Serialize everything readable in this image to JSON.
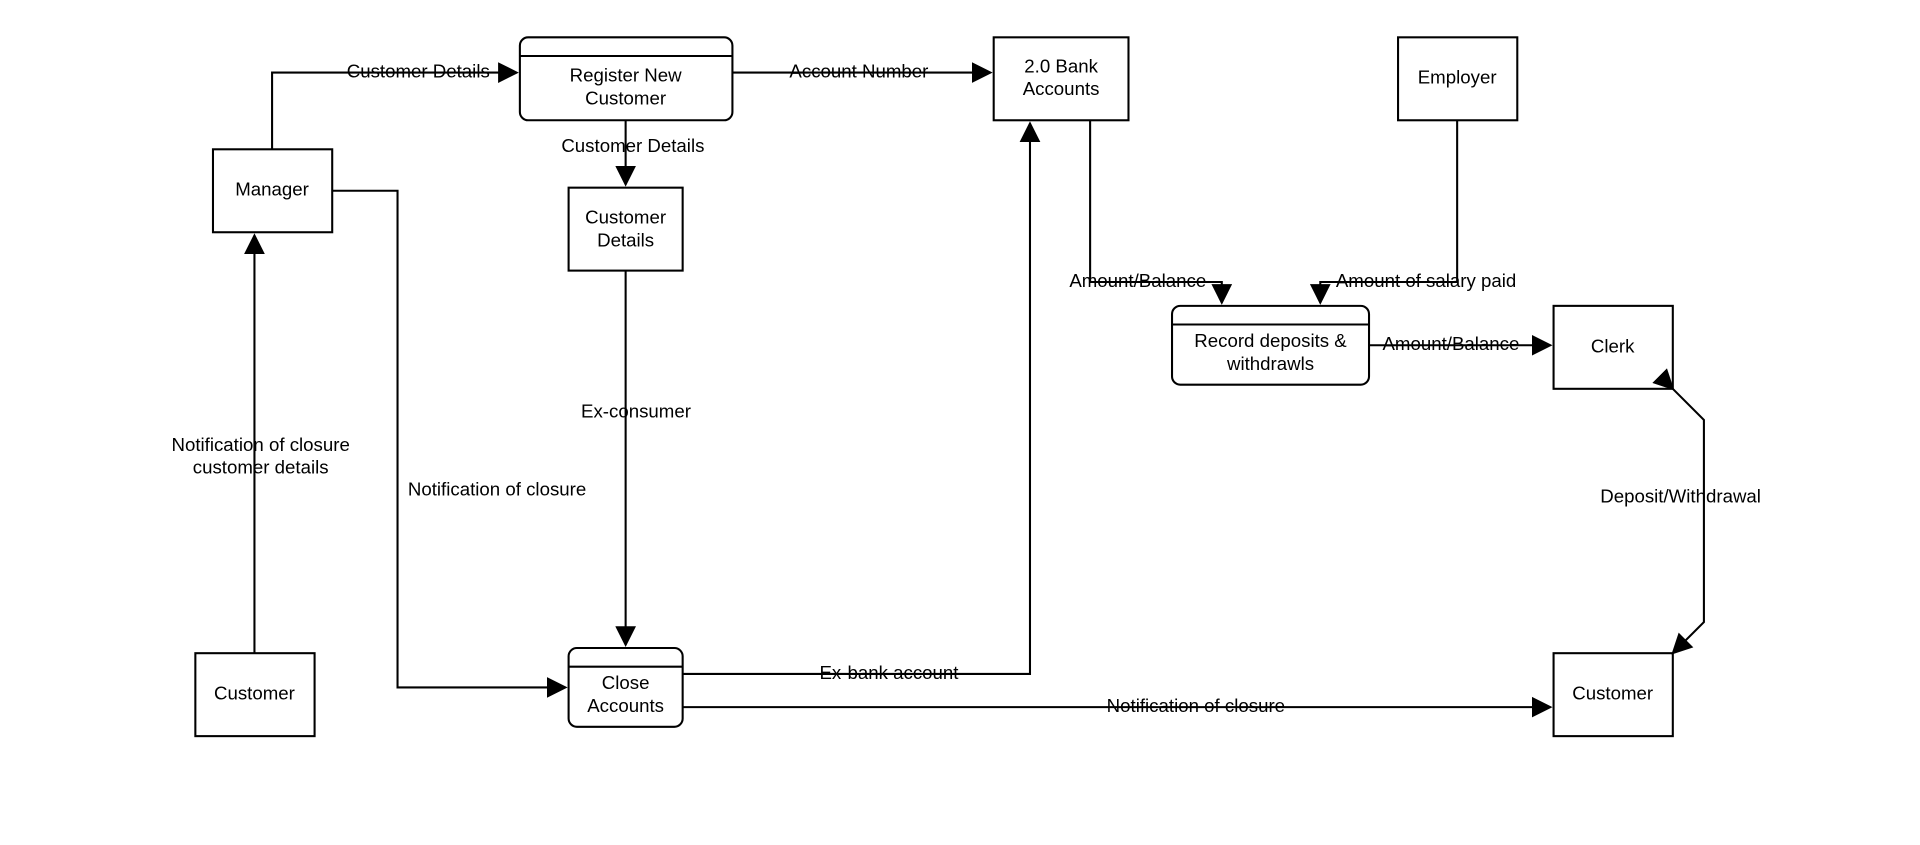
{
  "nodes": {
    "manager": {
      "label": "Manager"
    },
    "customer_left": {
      "label": "Customer"
    },
    "customer_right": {
      "label": "Customer"
    },
    "employer": {
      "label": "Employer"
    },
    "clerk": {
      "label": "Clerk"
    },
    "register": {
      "label1": "Register New",
      "label2": "Customer"
    },
    "cust_details_ds": {
      "label1": "Customer",
      "label2": "Details"
    },
    "close_accounts": {
      "label1": "Close",
      "label2": "Accounts"
    },
    "bank_accounts": {
      "label1": "2.0 Bank",
      "label2": "Accounts"
    },
    "record": {
      "label1": "Record deposits &",
      "label2": "withdrawls"
    }
  },
  "edges": {
    "mgr_to_reg": "Customer Details",
    "reg_to_bank": "Account Number",
    "reg_to_custds": "Customer Details",
    "custds_to_close": "Ex-consumer",
    "mgr_to_close": "Notification of closure",
    "close_to_bank": "Ex-bank account",
    "close_to_custR": "Notification of closure",
    "custL_to_mgr_l1": "Notification of closure",
    "custL_to_mgr_l2": "customer details",
    "bank_to_record": "Amount/Balance",
    "employer_to_record": "Amount of salary paid",
    "record_to_clerk": "Amount/Balance",
    "clerk_custR": "Deposit/Withdrawal"
  }
}
